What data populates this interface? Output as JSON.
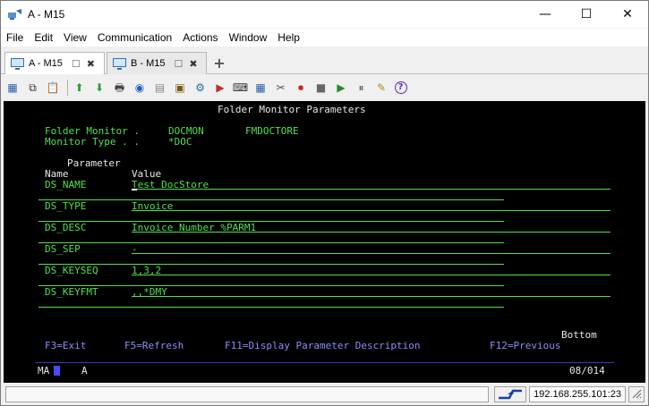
{
  "window": {
    "title": "A - M15",
    "minimize_glyph": "—",
    "maximize_glyph": "☐",
    "close_glyph": "✕"
  },
  "menu": [
    "File",
    "Edit",
    "View",
    "Communication",
    "Actions",
    "Window",
    "Help"
  ],
  "tabs": [
    {
      "label": "A - M15",
      "active": true
    },
    {
      "label": "B - M15",
      "active": false
    }
  ],
  "tab_controls": {
    "restore_glyph": "☐",
    "close_glyph": "✖",
    "add_glyph": "+"
  },
  "toolbar_icons": [
    "copy-screen-icon",
    "copy-icon",
    "paste-icon",
    "send-file-icon",
    "receive-file-icon",
    "print-icon",
    "navigate-icon",
    "notepad-icon",
    "macro-icon",
    "settings-icon",
    "run-icon",
    "keyboard-icon",
    "keypad-icon",
    "tools-icon",
    "record-icon",
    "stop-icon",
    "play-icon",
    "pause-icon",
    "notes-icon",
    "help-icon"
  ],
  "toolbar_glyphs": [
    "▦",
    "⧉",
    "📋",
    "⬆",
    "⬇",
    "🖶",
    "◉",
    "▤",
    "▣",
    "⚙",
    "▶",
    "⌨",
    "▦",
    "✂",
    "⏺",
    "■",
    "▶",
    "⏸",
    "✎",
    "?"
  ],
  "terminal": {
    "screen_title": "Folder Monitor Parameters",
    "folder_monitor_label": "Folder Monitor .",
    "folder_monitor_value": "DOCMON",
    "folder_monitor_value2": "FMDOCTORE",
    "monitor_type_label": "Monitor Type . .",
    "monitor_type_value": "*DOC",
    "header_parameter": "Parameter",
    "header_name": "Name",
    "header_value": "Value",
    "parameters": [
      {
        "name": "DS_NAME",
        "value": "Test DocStore"
      },
      {
        "name": "DS_TYPE",
        "value": "Invoice"
      },
      {
        "name": "DS_DESC",
        "value": "Invoice Number %PARM1"
      },
      {
        "name": "DS_SEP",
        "value": "-"
      },
      {
        "name": "DS_KEYSEQ",
        "value": "1,3,2"
      },
      {
        "name": "DS_KEYFMT",
        "value": ",,*DMY"
      }
    ],
    "bottom_label": "Bottom",
    "function_keys": [
      "F3=Exit",
      "F5=Refresh",
      "F11=Display Parameter Description",
      "F12=Previous"
    ],
    "oia_left": "MA",
    "oia_session": "A",
    "cursor_position": "08/014"
  },
  "statusbar": {
    "ip": "192.168.255.101:23"
  },
  "colors": {
    "terminal_bg": "#000000",
    "terminal_green": "#4fe04f",
    "terminal_white": "#e8e8e8",
    "terminal_blue": "#8c8cff"
  }
}
